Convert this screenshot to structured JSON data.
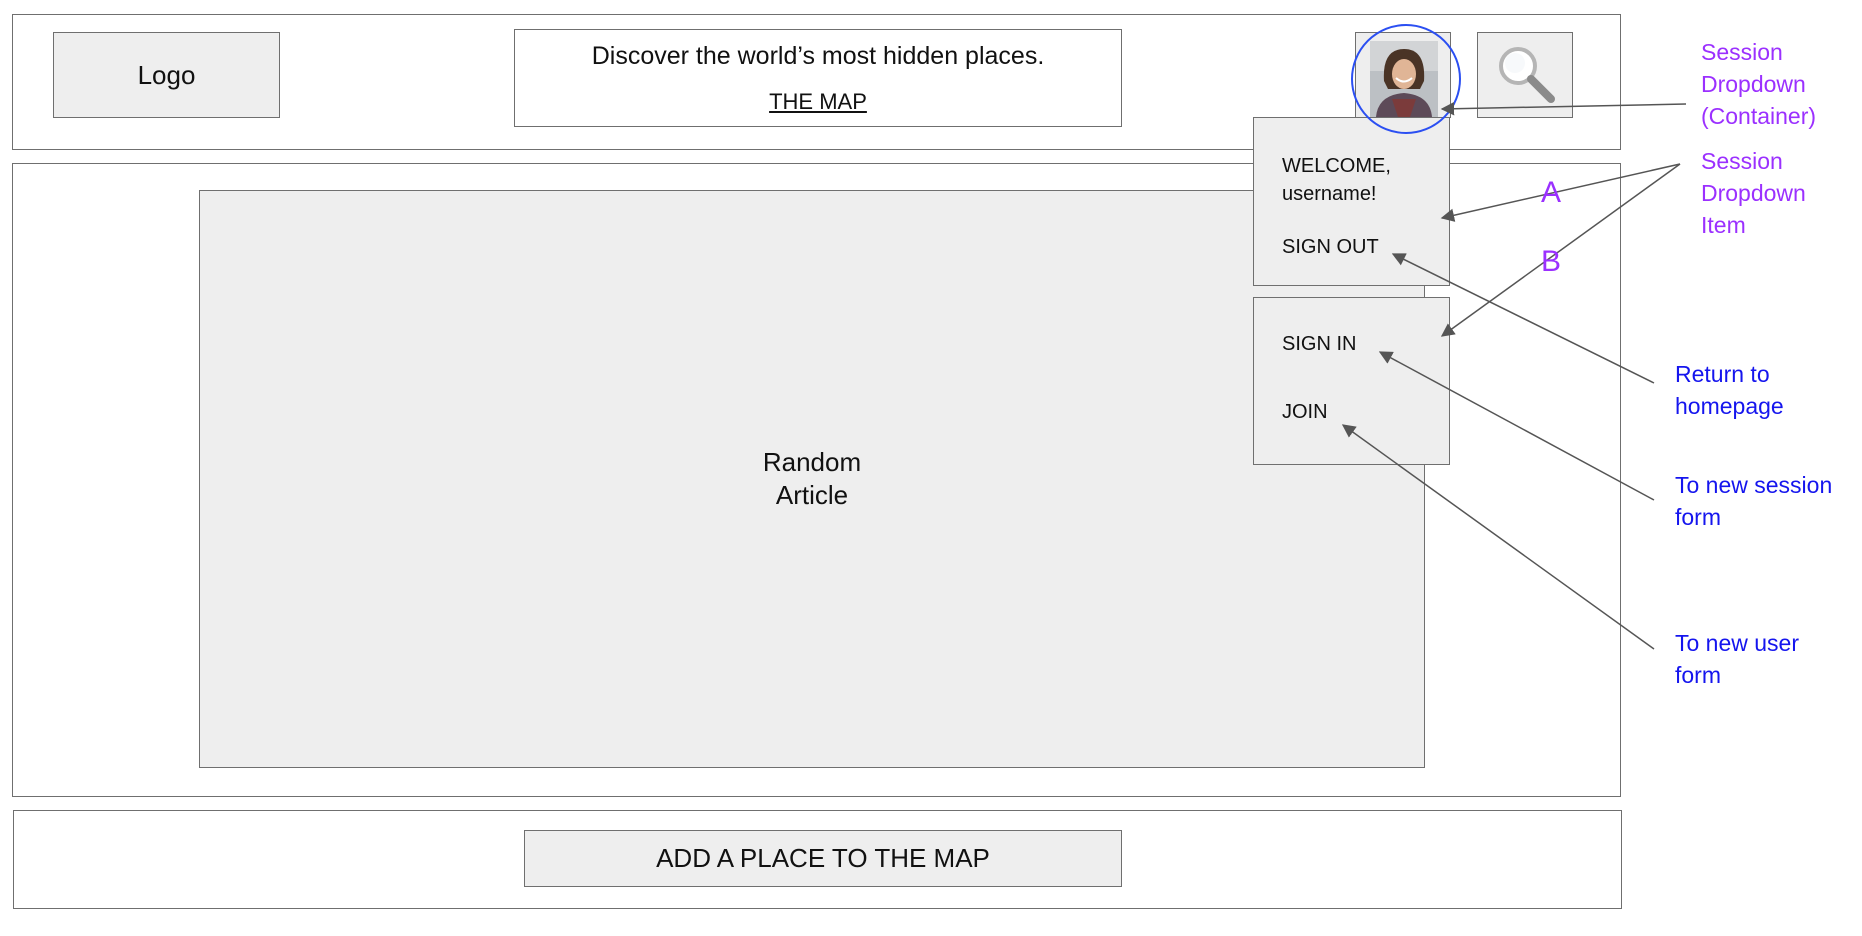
{
  "header": {
    "logo_label": "Logo",
    "tagline": "Discover the world’s most hidden places.",
    "map_link": "THE MAP"
  },
  "main": {
    "article_line1": "Random",
    "article_line2": "Article"
  },
  "footer": {
    "add_place_label": "ADD A PLACE TO THE MAP"
  },
  "dropdown_a": {
    "welcome_line1": "WELCOME,",
    "welcome_line2": "username!",
    "sign_out": "SIGN OUT"
  },
  "dropdown_b": {
    "sign_in": "SIGN IN",
    "join": "JOIN"
  },
  "annotations": {
    "container_line1": "Session",
    "container_line2": "Dropdown",
    "container_line3": "(Container)",
    "item_line1": "Session",
    "item_line2": "Dropdown",
    "item_line3": "Item",
    "letter_a": "A",
    "letter_b": "B",
    "return_line1": "Return to",
    "return_line2": "homepage",
    "session_line1": "To new session",
    "session_line2": "form",
    "user_line1": "To new user",
    "user_line2": "form"
  },
  "colors": {
    "annotation_purple": "#9b30ff",
    "annotation_blue": "#1515ee",
    "highlight_circle": "#2b4ff2",
    "wireframe_fill": "#eeeeee"
  },
  "icons": {
    "search": "magnifier-icon",
    "avatar": "user-photo"
  }
}
